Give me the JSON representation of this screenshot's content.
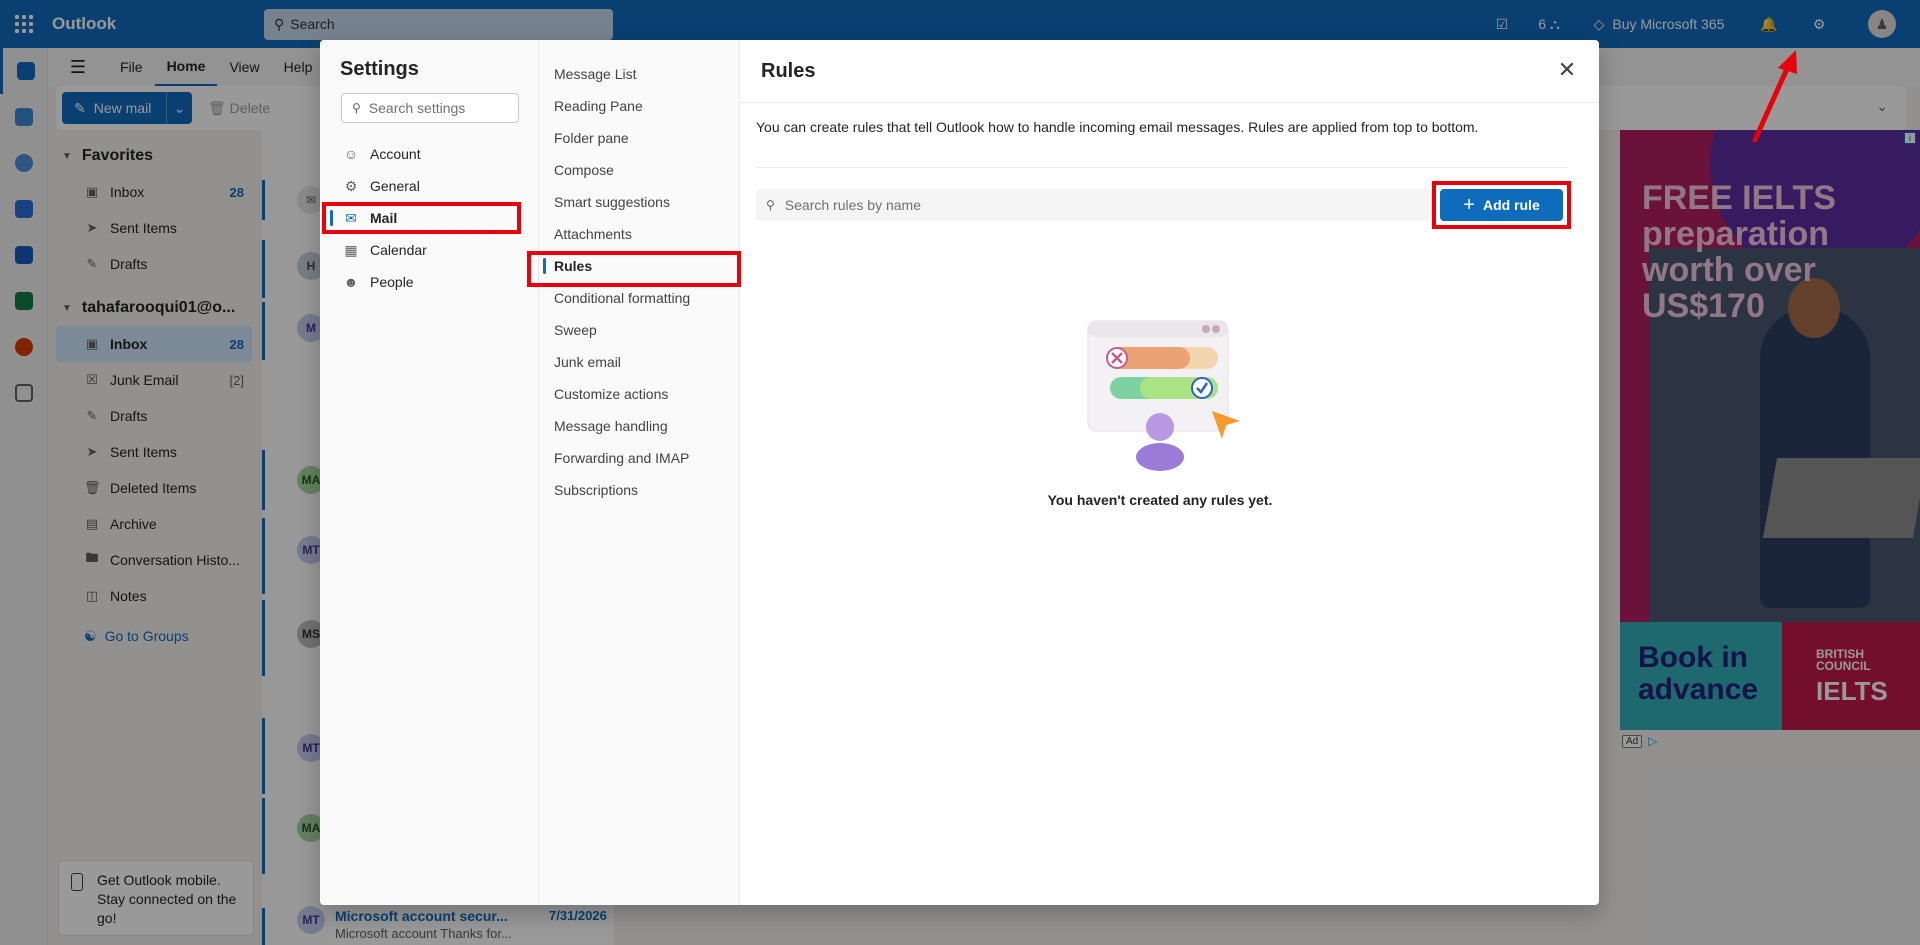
{
  "app": {
    "title": "Outlook",
    "search_placeholder": "Search"
  },
  "topbar": {
    "badge_count": "6",
    "buy_label": "Buy Microsoft 365"
  },
  "ribbon": {
    "tabs": [
      "File",
      "Home",
      "View",
      "Help"
    ],
    "selected_tab": "Home",
    "new_mail": "New mail",
    "delete": "Delete"
  },
  "folders": {
    "favorites_label": "Favorites",
    "favorites": [
      {
        "label": "Inbox",
        "count": "28"
      },
      {
        "label": "Sent Items",
        "count": ""
      },
      {
        "label": "Drafts",
        "count": ""
      }
    ],
    "account_label": "tahafarooqui01@o...",
    "account_items": [
      {
        "label": "Inbox",
        "count": "28"
      },
      {
        "label": "Junk Email",
        "count": "[2]"
      },
      {
        "label": "Drafts",
        "count": ""
      },
      {
        "label": "Sent Items",
        "count": ""
      },
      {
        "label": "Deleted Items",
        "count": ""
      },
      {
        "label": "Archive",
        "count": ""
      },
      {
        "label": "Conversation Histo...",
        "count": ""
      },
      {
        "label": "Notes",
        "count": ""
      }
    ],
    "go_to_groups": "Go to Groups"
  },
  "mobile_promo": "Get Outlook mobile. Stay connected on the go!",
  "message_list": {
    "avatars": [
      "H",
      "M",
      "MA",
      "MT",
      "MS",
      "MT",
      "MA"
    ],
    "last": {
      "from": "Microsoft account secur...",
      "date": "7/31/2026",
      "preview": "Microsoft account Thanks for..."
    }
  },
  "ad": {
    "headline": "FREE IELTS preparation worth over US$170",
    "cta": "Book in advance",
    "brand_top": "BRITISH COUNCIL",
    "brand_bottom": "IELTS",
    "ad_badge": "Ad"
  },
  "settings": {
    "title": "Settings",
    "search_placeholder": "Search settings",
    "categories": [
      "Account",
      "General",
      "Mail",
      "Calendar",
      "People"
    ],
    "selected_category": "Mail",
    "mail_items": [
      "Message List",
      "Reading Pane",
      "Folder pane",
      "Compose",
      "Smart suggestions",
      "Attachments",
      "Rules",
      "Conditional formatting",
      "Sweep",
      "Junk email",
      "Customize actions",
      "Message handling",
      "Forwarding and IMAP",
      "Subscriptions"
    ],
    "selected_mail_item": "Rules"
  },
  "rules": {
    "title": "Rules",
    "description": "You can create rules that tell Outlook how to handle incoming email messages. Rules are applied from top to bottom.",
    "search_placeholder": "Search rules by name",
    "add_rule": "Add rule",
    "empty_state": "You haven't created any rules yet."
  },
  "colors": {
    "accent": "#0f6cbd",
    "highlight": "#e8000b"
  }
}
